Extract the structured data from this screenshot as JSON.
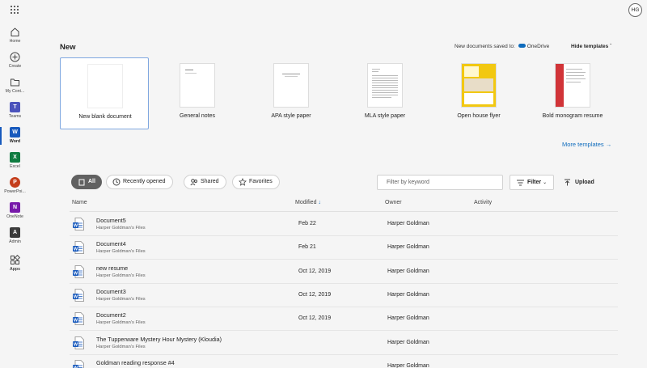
{
  "header": {
    "avatar_initials": "HG"
  },
  "rail": [
    {
      "label": "Home",
      "icon": "home-icon"
    },
    {
      "label": "Create",
      "icon": "plus-circle-icon"
    },
    {
      "label": "My Cont...",
      "icon": "folder-icon"
    },
    {
      "label": "Teams",
      "icon": "teams-icon",
      "color": "#4b53bc"
    },
    {
      "label": "Word",
      "icon": "word-icon",
      "color": "#185abd",
      "active": true
    },
    {
      "label": "Excel",
      "icon": "excel-icon",
      "color": "#107c41"
    },
    {
      "label": "PowerPoi...",
      "icon": "powerpoint-icon",
      "color": "#c43e1c"
    },
    {
      "label": "OneNote",
      "icon": "onenote-icon",
      "color": "#7719aa"
    },
    {
      "label": "Admin",
      "icon": "admin-icon"
    },
    {
      "label": "Apps",
      "icon": "apps-icon"
    }
  ],
  "new_section": {
    "title": "New",
    "saved_to_prefix": "New documents saved to:",
    "saved_to_location": "OneDrive",
    "hide_templates": "Hide templates",
    "more_templates": "More templates",
    "templates": [
      {
        "label": "New blank document"
      },
      {
        "label": "General notes"
      },
      {
        "label": "APA style paper"
      },
      {
        "label": "MLA style paper"
      },
      {
        "label": "Open house flyer"
      },
      {
        "label": "Bold monogram resume"
      }
    ]
  },
  "filters": {
    "pills": [
      "All",
      "Recently opened",
      "Shared",
      "Favorites"
    ],
    "search_placeholder": "Filter by keyword",
    "filter_label": "Filter",
    "upload_label": "Upload"
  },
  "table": {
    "columns": {
      "name": "Name",
      "modified": "Modified",
      "owner": "Owner",
      "activity": "Activity"
    },
    "rows": [
      {
        "name": "Document5",
        "location": "Harper Goldman's Files",
        "modified": "Feb 22",
        "owner": "Harper Goldman"
      },
      {
        "name": "Document4",
        "location": "Harper Goldman's Files",
        "modified": "Feb 21",
        "owner": "Harper Goldman"
      },
      {
        "name": "new resume",
        "location": "Harper Goldman's Files",
        "modified": "Oct 12, 2019",
        "owner": "Harper Goldman"
      },
      {
        "name": "Document3",
        "location": "Harper Goldman's Files",
        "modified": "Oct 12, 2019",
        "owner": "Harper Goldman"
      },
      {
        "name": "Document2",
        "location": "Harper Goldman's Files",
        "modified": "Oct 12, 2019",
        "owner": "Harper Goldman"
      },
      {
        "name": "The Tupperware Mystery Hour Mystery (Kloudia)",
        "location": "Harper Goldman's Files",
        "modified": "",
        "owner": "Harper Goldman"
      },
      {
        "name": "Goldman reading response #4",
        "location": "",
        "modified": "",
        "owner": "Harper Goldman"
      }
    ]
  },
  "colors": {
    "accent": "#0f6cbd",
    "word": "#185abd",
    "flyer_yellow": "#f2c811",
    "resume_red": "#d13438"
  }
}
